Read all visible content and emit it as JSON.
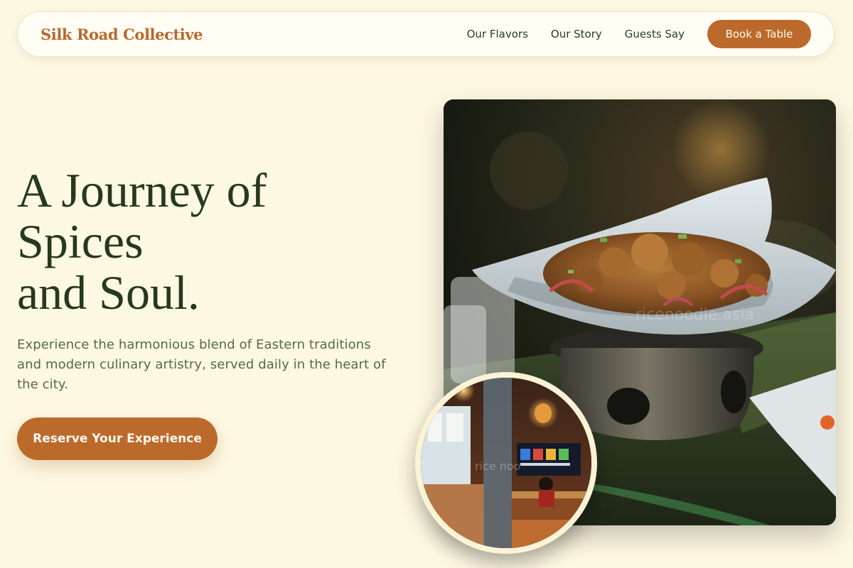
{
  "nav": {
    "brand": "Silk Road Collective",
    "links": [
      "Our Flavors",
      "Our Story",
      "Guests Say"
    ],
    "cta": "Book a Table"
  },
  "hero": {
    "title_lines": [
      "A Journey of",
      "Spices",
      "and Soul."
    ],
    "description": "Experience the harmonious blend of Eastern traditions and modern culinary artistry, served daily in the heart of the city.",
    "cta": "Reserve Your Experience"
  },
  "images": {
    "food_watermark": "ricenoodle.asia",
    "interior_watermark": "rice noo"
  },
  "colors": {
    "background": "#fdf8e1",
    "accent": "#bc6a2c",
    "heading": "#27381f",
    "body_text": "#57694c"
  }
}
